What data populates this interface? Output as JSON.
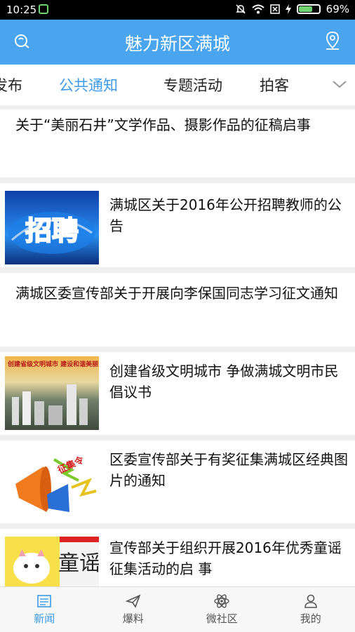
{
  "status": {
    "time": "10:25",
    "battery": "69%",
    "battery_level": 0.69
  },
  "header": {
    "title": "魅力新区满城"
  },
  "tabs": [
    {
      "label": "发布"
    },
    {
      "label": "公共通知",
      "active": true
    },
    {
      "label": "专题活动"
    },
    {
      "label": "拍客"
    }
  ],
  "articles": [
    {
      "title": "关于“美丽石井”文学作品、摄影作品的征稿启事",
      "image": false
    },
    {
      "title": "满城区关于2016年公开招聘教师的公告",
      "image": true,
      "image_text": "招聘"
    },
    {
      "title": "满城区委宣传部关于开展向李保国同志学习征文通知",
      "image": false
    },
    {
      "title": "创建省级文明城市 争做满城文明市民倡议书",
      "image": true,
      "image_text": "创建省级文明城市 建设和谐美丽满城"
    },
    {
      "title": "区委宣传部关于有奖征集满城区经典图片的通知",
      "image": true,
      "image_text": "征集令"
    },
    {
      "title": "宣传部关于组织开展2016年优秀童谣征集活动的启 事",
      "image": true,
      "image_text": "童谣"
    }
  ],
  "nav": [
    {
      "label": "新闻",
      "icon": "news-icon",
      "active": true
    },
    {
      "label": "爆料",
      "icon": "send-icon"
    },
    {
      "label": "微社区",
      "icon": "atom-icon"
    },
    {
      "label": "我的",
      "icon": "user-icon"
    }
  ],
  "colors": {
    "primary": "#4ba5ee",
    "active": "#3d9ae8"
  }
}
